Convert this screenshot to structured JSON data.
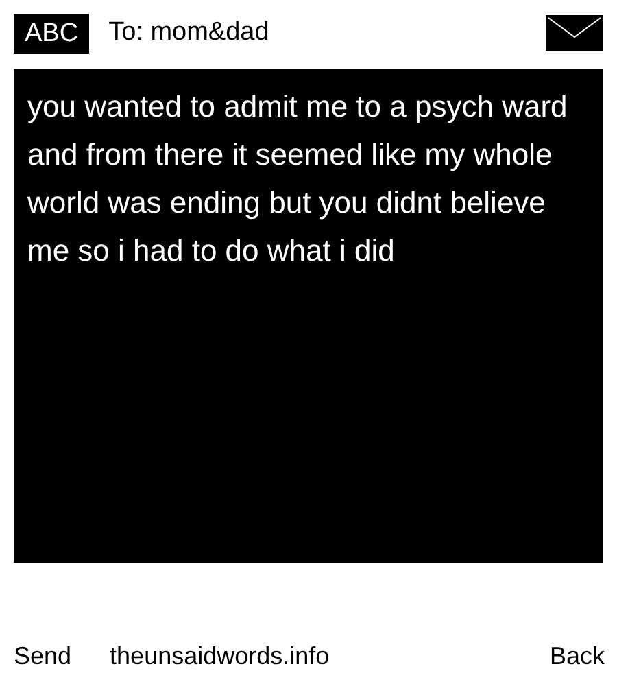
{
  "header": {
    "input_mode": "ABC",
    "recipient": "To: mom&dad"
  },
  "message": "you wanted to admit me to a psych ward and from there it seemed like my whole world was ending but you didnt believe me so i had to do what i did",
  "softkeys": {
    "left": "Send",
    "center": "theunsaidwords.info",
    "right": "Back"
  }
}
